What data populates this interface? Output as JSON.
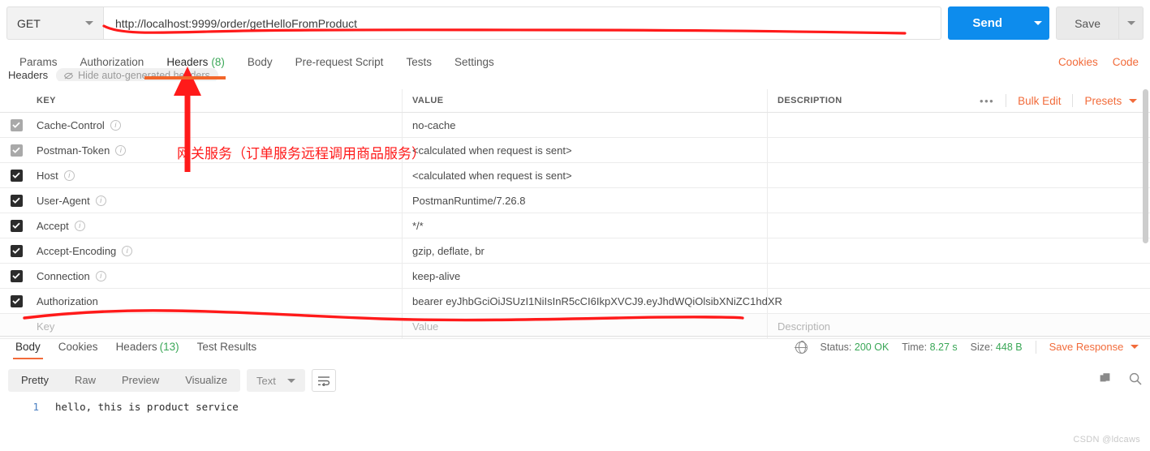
{
  "request": {
    "method": "GET",
    "url": "http://localhost:9999/order/getHelloFromProduct",
    "send_label": "Send",
    "save_label": "Save"
  },
  "tabs": [
    {
      "label": "Params",
      "count": ""
    },
    {
      "label": "Authorization",
      "count": ""
    },
    {
      "label": "Headers",
      "count": "(8)"
    },
    {
      "label": "Body",
      "count": ""
    },
    {
      "label": "Pre-request Script",
      "count": ""
    },
    {
      "label": "Tests",
      "count": ""
    },
    {
      "label": "Settings",
      "count": ""
    }
  ],
  "tabs_right": {
    "cookies": "Cookies",
    "code": "Code"
  },
  "headers_subbar": {
    "title": "Headers",
    "hide_auto": "Hide auto-generated headers"
  },
  "table": {
    "columns": {
      "key": "KEY",
      "value": "VALUE",
      "description": "DESCRIPTION"
    },
    "actions": {
      "dots": "•••",
      "bulk_edit": "Bulk Edit",
      "presets": "Presets"
    },
    "rows": [
      {
        "key": "Cache-Control",
        "value": "no-cache",
        "description": "",
        "checked": true,
        "muted": true,
        "info": true
      },
      {
        "key": "Postman-Token",
        "value": "<calculated when request is sent>",
        "description": "",
        "checked": true,
        "muted": true,
        "info": true
      },
      {
        "key": "Host",
        "value": "<calculated when request is sent>",
        "description": "",
        "checked": true,
        "muted": false,
        "info": true
      },
      {
        "key": "User-Agent",
        "value": "PostmanRuntime/7.26.8",
        "description": "",
        "checked": true,
        "muted": false,
        "info": true
      },
      {
        "key": "Accept",
        "value": "*/*",
        "description": "",
        "checked": true,
        "muted": false,
        "info": true
      },
      {
        "key": "Accept-Encoding",
        "value": "gzip, deflate, br",
        "description": "",
        "checked": true,
        "muted": false,
        "info": true
      },
      {
        "key": "Connection",
        "value": "keep-alive",
        "description": "",
        "checked": true,
        "muted": false,
        "info": true
      },
      {
        "key": "Authorization",
        "value": "bearer eyJhbGciOiJSUzI1NiIsInR5cCI6IkpXVCJ9.eyJhdWQiOlsibXNiZC1hdXR",
        "description": "",
        "checked": true,
        "muted": false,
        "info": false
      }
    ],
    "empty_row": {
      "key": "Key",
      "value": "Value",
      "description": "Description"
    }
  },
  "response": {
    "tabs": [
      {
        "label": "Body",
        "count": ""
      },
      {
        "label": "Cookies",
        "count": ""
      },
      {
        "label": "Headers",
        "count": "(13)"
      },
      {
        "label": "Test Results",
        "count": ""
      }
    ],
    "status": {
      "status_label": "Status:",
      "status_value": "200 OK",
      "time_label": "Time:",
      "time_value": "8.27 s",
      "size_label": "Size:",
      "size_value": "448 B",
      "save_response": "Save Response"
    },
    "viewer": {
      "modes": [
        "Pretty",
        "Raw",
        "Preview",
        "Visualize"
      ],
      "format": "Text"
    },
    "body": {
      "line_number": "1",
      "text": "hello, this is product service"
    }
  },
  "annotations": {
    "chinese_note": "网关服务（订单服务远程调用商品服务）"
  },
  "watermark": "CSDN @ldcaws",
  "colors": {
    "accent_blue": "#0d8ced",
    "accent_orange": "#f26b3a",
    "status_green": "#3aa757",
    "annotation_red": "#ff1a1a"
  }
}
